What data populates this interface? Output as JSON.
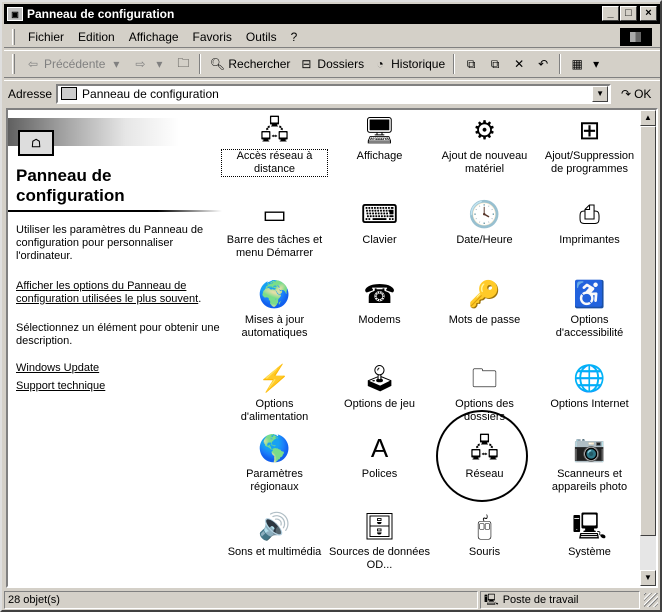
{
  "window": {
    "title": "Panneau de configuration"
  },
  "menu": [
    "Fichier",
    "Edition",
    "Affichage",
    "Favoris",
    "Outils",
    "?"
  ],
  "toolbar": {
    "back": "Précédente",
    "search": "Rechercher",
    "folders": "Dossiers",
    "history": "Historique"
  },
  "address": {
    "label": "Adresse",
    "value": "Panneau de configuration",
    "go": "OK"
  },
  "left_pane": {
    "title": "Panneau de configuration",
    "intro": "Utiliser les paramètres du Panneau de configuration pour personnaliser l'ordinateur.",
    "link_all_options": "Afficher les options du Panneau de configuration utilisées le plus souvent",
    "select_hint": "Sélectionnez un élément pour obtenir une description.",
    "link_windows_update": "Windows Update",
    "link_support": "Support technique"
  },
  "items": [
    {
      "label": "Accès réseau à distance",
      "icon": "dialup-networking-icon"
    },
    {
      "label": "Affichage",
      "icon": "display-icon"
    },
    {
      "label": "Ajout de nouveau matériel",
      "icon": "add-hardware-icon"
    },
    {
      "label": "Ajout/Suppression de programmes",
      "icon": "add-remove-programs-icon"
    },
    {
      "label": "Barre des tâches et menu Démarrer",
      "icon": "taskbar-icon"
    },
    {
      "label": "Clavier",
      "icon": "keyboard-icon"
    },
    {
      "label": "Date/Heure",
      "icon": "date-time-icon"
    },
    {
      "label": "Imprimantes",
      "icon": "printers-icon"
    },
    {
      "label": "Mises à jour automatiques",
      "icon": "auto-update-icon"
    },
    {
      "label": "Modems",
      "icon": "modem-icon"
    },
    {
      "label": "Mots de passe",
      "icon": "passwords-icon"
    },
    {
      "label": "Options d'accessibilité",
      "icon": "accessibility-icon"
    },
    {
      "label": "Options d'alimentation",
      "icon": "power-icon"
    },
    {
      "label": "Options de jeu",
      "icon": "game-controller-icon"
    },
    {
      "label": "Options des dossiers",
      "icon": "folder-options-icon"
    },
    {
      "label": "Options Internet",
      "icon": "internet-options-icon"
    },
    {
      "label": "Paramètres régionaux",
      "icon": "globe-icon"
    },
    {
      "label": "Polices",
      "icon": "fonts-icon"
    },
    {
      "label": "Réseau",
      "icon": "network-icon"
    },
    {
      "label": "Scanneurs et appareils photo",
      "icon": "scanner-camera-icon"
    },
    {
      "label": "Sons et multimédia",
      "icon": "speaker-icon"
    },
    {
      "label": "Sources de données OD...",
      "icon": "odbc-icon"
    },
    {
      "label": "Souris",
      "icon": "mouse-icon"
    },
    {
      "label": "Système",
      "icon": "system-icon"
    }
  ],
  "status": {
    "count": "28 objet(s)",
    "zone": "Poste de travail"
  }
}
